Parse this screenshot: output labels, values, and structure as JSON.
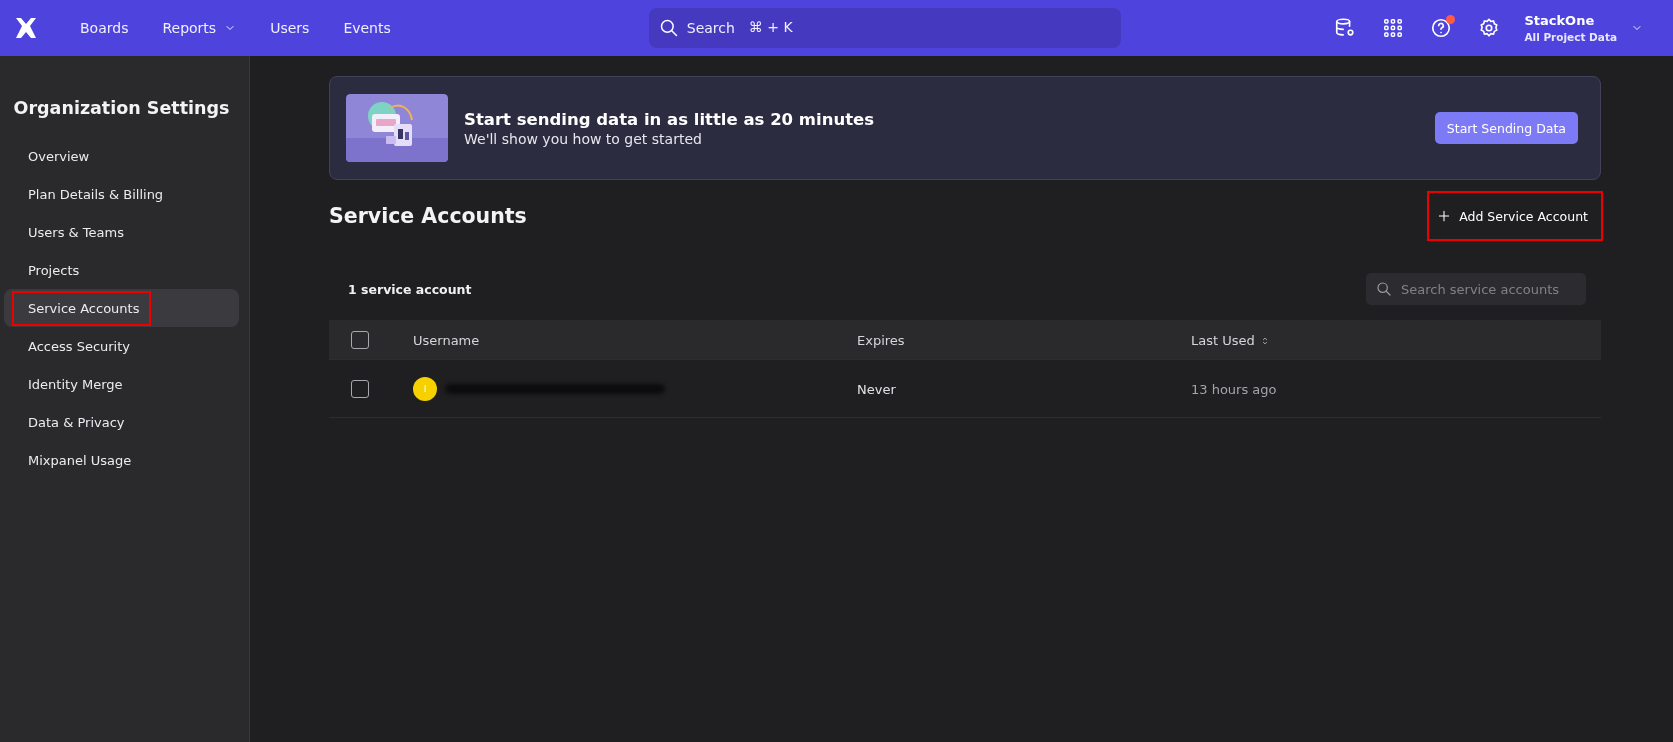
{
  "top_bar": {
    "nav": [
      {
        "label": "Boards",
        "dropdown": false
      },
      {
        "label": "Reports",
        "dropdown": true
      },
      {
        "label": "Users",
        "dropdown": false
      },
      {
        "label": "Events",
        "dropdown": false
      }
    ],
    "search": {
      "placeholder": "Search",
      "shortcut": "⌘ + K"
    },
    "help_notification": true,
    "account": {
      "name": "StackOne",
      "project": "All Project Data"
    }
  },
  "sidebar": {
    "title": "Organization Settings",
    "items": [
      {
        "label": "Overview",
        "selected": false,
        "highlighted": false
      },
      {
        "label": "Plan Details & Billing",
        "selected": false,
        "highlighted": false
      },
      {
        "label": "Users & Teams",
        "selected": false,
        "highlighted": false
      },
      {
        "label": "Projects",
        "selected": false,
        "highlighted": false
      },
      {
        "label": "Service Accounts",
        "selected": true,
        "highlighted": true
      },
      {
        "label": "Access Security",
        "selected": false,
        "highlighted": false
      },
      {
        "label": "Identity Merge",
        "selected": false,
        "highlighted": false
      },
      {
        "label": "Data & Privacy",
        "selected": false,
        "highlighted": false
      },
      {
        "label": "Mixpanel Usage",
        "selected": false,
        "highlighted": false
      }
    ]
  },
  "banner": {
    "title": "Start sending data in as little as 20 minutes",
    "subtitle": "We'll show you how to get started",
    "button": "Start Sending Data"
  },
  "page": {
    "title": "Service Accounts",
    "add_button": {
      "label": "Add Service Account",
      "highlighted": true
    }
  },
  "table": {
    "count": "1 service account",
    "search": {
      "placeholder": "Search service accounts"
    },
    "select_all_checked": false,
    "columns": [
      {
        "label": "Username",
        "sortable": false
      },
      {
        "label": "Expires",
        "sortable": false
      },
      {
        "label": "Last Used",
        "sortable": true
      }
    ],
    "rows": [
      {
        "checked": false,
        "avatar": "I",
        "color": "#f7d000",
        "username_redacted": true,
        "expires": "Never",
        "last_used": "13 hours ago"
      }
    ]
  }
}
